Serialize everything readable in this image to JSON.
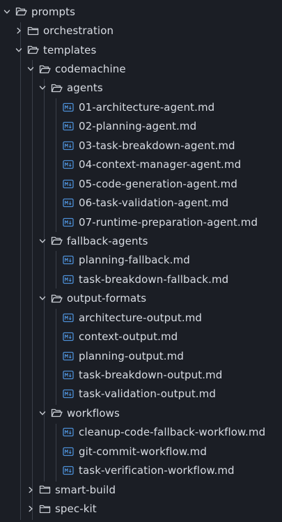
{
  "tree": {
    "prompts": "prompts",
    "orchestration": "orchestration",
    "templates": "templates",
    "codemachine": "codemachine",
    "agents": {
      "label": "agents",
      "files": [
        "01-architecture-agent.md",
        "02-planning-agent.md",
        "03-task-breakdown-agent.md",
        "04-context-manager-agent.md",
        "05-code-generation-agent.md",
        "06-task-validation-agent.md",
        "07-runtime-preparation-agent.md"
      ]
    },
    "fallback_agents": {
      "label": "fallback-agents",
      "files": [
        "planning-fallback.md",
        "task-breakdown-fallback.md"
      ]
    },
    "output_formats": {
      "label": "output-formats",
      "files": [
        "architecture-output.md",
        "context-output.md",
        "planning-output.md",
        "task-breakdown-output.md",
        "task-validation-output.md"
      ]
    },
    "workflows": {
      "label": "workflows",
      "files": [
        "cleanup-code-fallback-workflow.md",
        "git-commit-workflow.md",
        "task-verification-workflow.md"
      ]
    },
    "smart_build": "smart-build",
    "spec_kit": "spec-kit"
  },
  "icons": {
    "folder_open": "folder-open-icon",
    "folder_closed": "folder-icon",
    "markdown": "markdown-file-icon",
    "expanded": "chevron-down-icon",
    "collapsed": "chevron-right-icon"
  },
  "colors": {
    "background": "#1b1e25",
    "text": "#d8dce3",
    "icon": "#c9cdd4",
    "markdown_icon": "#4d8fd6",
    "guide": "#3a3f49"
  }
}
